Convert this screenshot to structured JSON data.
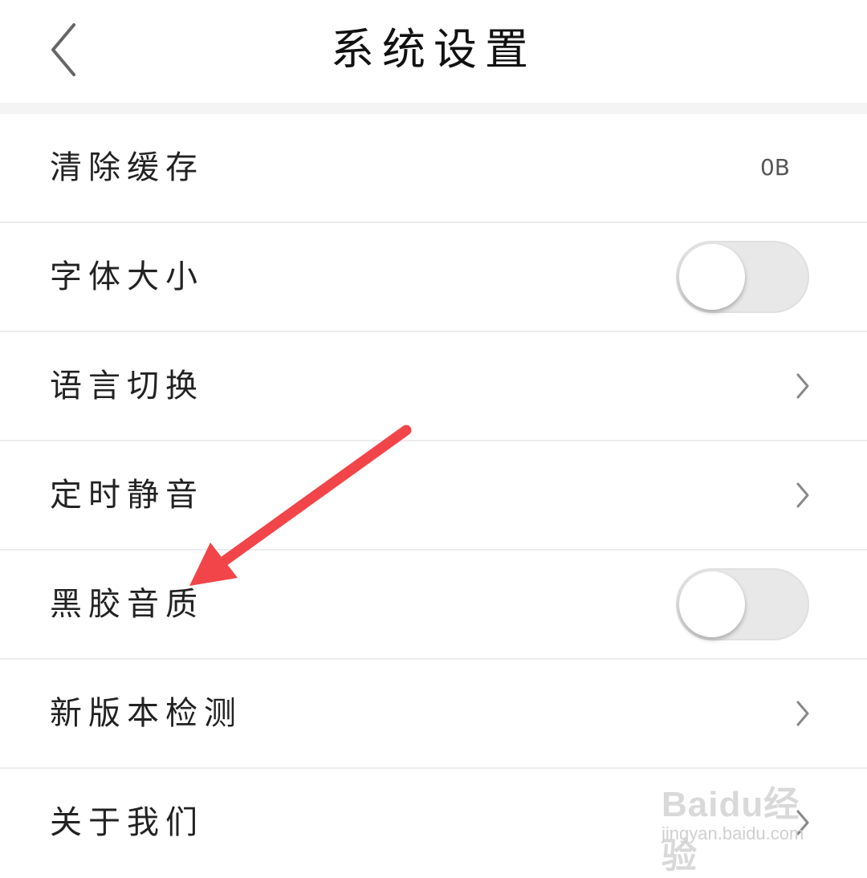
{
  "header": {
    "title": "系统设置",
    "back_icon": "chevron-left-icon"
  },
  "settings": [
    {
      "label": "清除缓存",
      "control": "value",
      "value": "0B"
    },
    {
      "label": "字体大小",
      "control": "toggle",
      "on": false
    },
    {
      "label": "语言切换",
      "control": "chevron"
    },
    {
      "label": "定时静音",
      "control": "chevron"
    },
    {
      "label": "黑胶音质",
      "control": "toggle",
      "on": false
    },
    {
      "label": "新版本检测",
      "control": "chevron"
    },
    {
      "label": "关于我们",
      "control": "chevron"
    }
  ],
  "annotation": {
    "type": "arrow",
    "color": "#f2454a",
    "target": "黑胶音质"
  },
  "watermark": {
    "brand": "Baidu经验",
    "url": "jingyan.baidu.com"
  },
  "colors": {
    "divider": "#ececec",
    "toggle_track": "#e8e8e8",
    "chevron": "#888888"
  }
}
